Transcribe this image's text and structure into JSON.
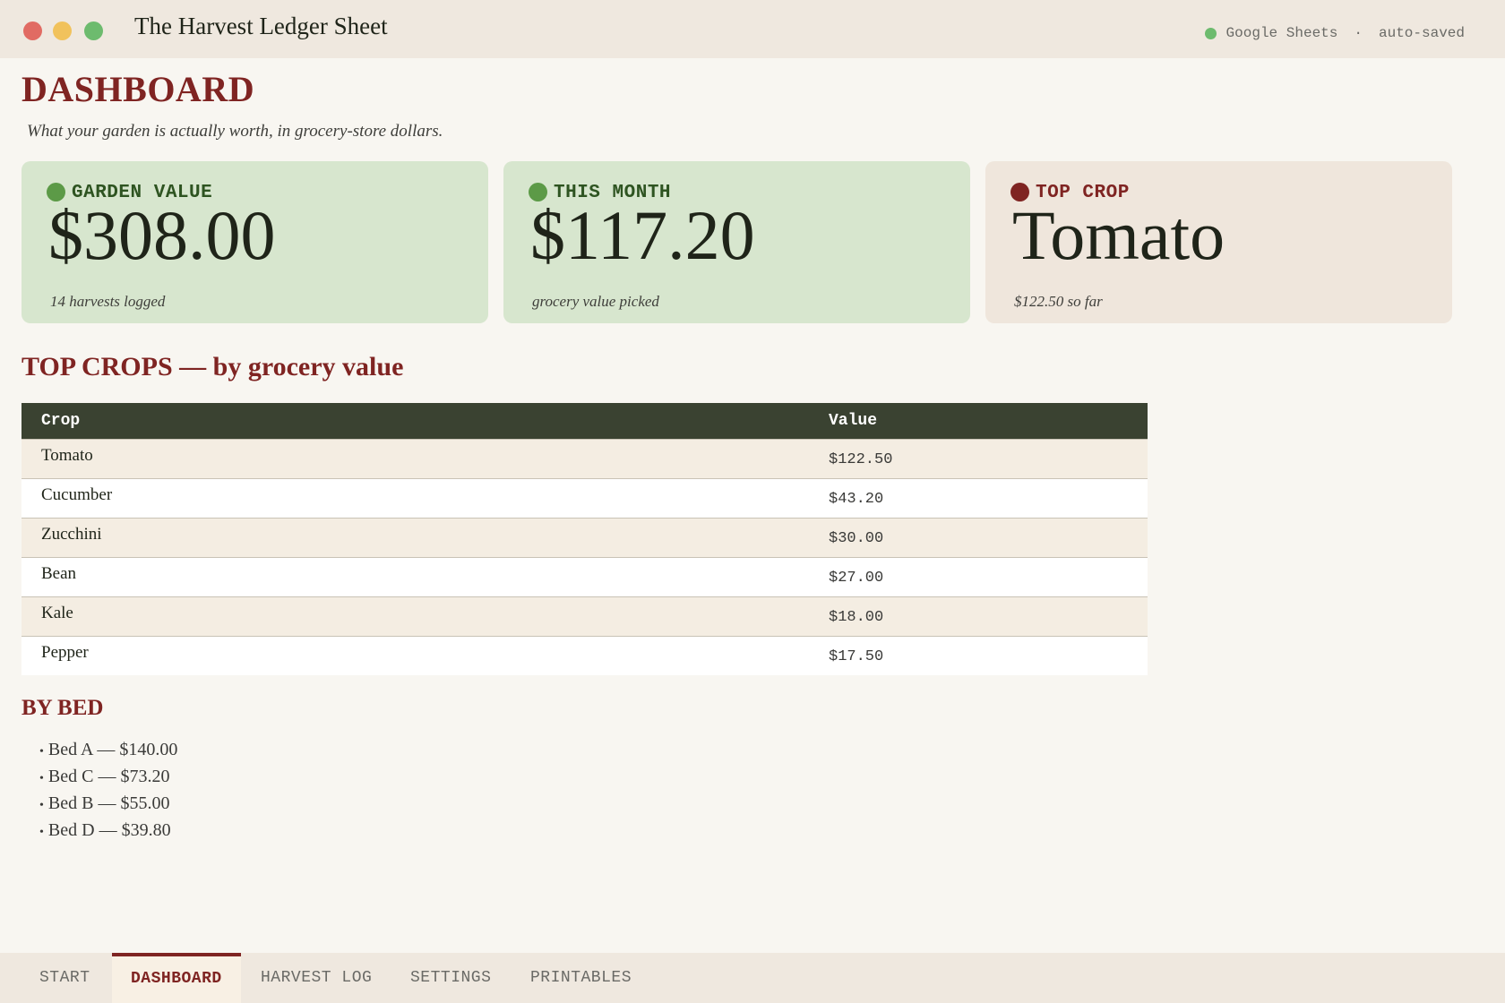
{
  "window": {
    "title": "The Harvest Ledger Sheet",
    "status_app": "Google Sheets",
    "status_sep": "·",
    "status_save": "auto-saved"
  },
  "page": {
    "title": "DASHBOARD",
    "tagline": "What your garden is actually worth, in grocery-store dollars."
  },
  "cards": [
    {
      "label": "GARDEN VALUE",
      "value": "$308.00",
      "note": "14 harvests logged"
    },
    {
      "label": "THIS MONTH",
      "value": "$117.20",
      "note": "grocery value picked"
    },
    {
      "label": "TOP CROP",
      "value": "Tomato",
      "note": "$122.50 so far"
    }
  ],
  "top_crops": {
    "title": "TOP CROPS — by grocery value",
    "columns": [
      "Crop",
      "Value"
    ],
    "rows": [
      {
        "crop": "Tomato",
        "value": "$122.50"
      },
      {
        "crop": "Cucumber",
        "value": "$43.20"
      },
      {
        "crop": "Zucchini",
        "value": "$30.00"
      },
      {
        "crop": "Bean",
        "value": "$27.00"
      },
      {
        "crop": "Kale",
        "value": "$18.00"
      },
      {
        "crop": "Pepper",
        "value": "$17.50"
      }
    ]
  },
  "by_bed": {
    "title": "BY BED",
    "bullet": "•",
    "items": [
      "Bed A — $140.00",
      "Bed C — $73.20",
      "Bed B — $55.00",
      "Bed D — $39.80"
    ]
  },
  "tabs": [
    "START",
    "DASHBOARD",
    "HARVEST LOG",
    "SETTINGS",
    "PRINTABLES"
  ],
  "active_tab": "DASHBOARD",
  "colors": {
    "accent": "#7f2422",
    "card_green": "#d7e6ce",
    "card_tan": "#efe6dc",
    "table_header": "#3a4231",
    "status_dot": "#6dbb6e"
  },
  "icons": {
    "window_controls": [
      "close-icon",
      "minimize-icon",
      "maximize-icon"
    ],
    "status": "status-dot-icon",
    "card_markers": [
      "green-dot-icon",
      "green-dot-icon",
      "red-dot-icon"
    ]
  }
}
